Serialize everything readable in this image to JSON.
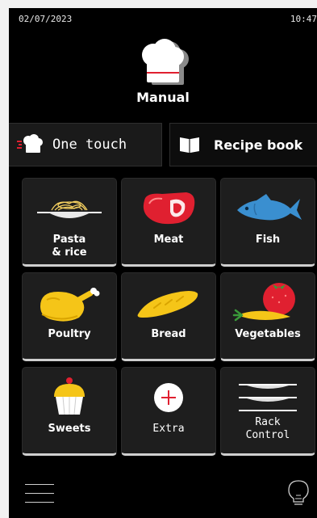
{
  "status": {
    "date": "02/07/2023",
    "time": "10:47"
  },
  "mode": {
    "title": "Manual",
    "icon": "chef-hat-icon"
  },
  "tabs": [
    {
      "label": "One touch",
      "icon": "chef-hat-icon"
    },
    {
      "label": "Recipe book",
      "icon": "open-book-icon"
    }
  ],
  "tiles": [
    {
      "label": "Pasta\n& rice",
      "icon": "pasta-plate-icon"
    },
    {
      "label": "Meat",
      "icon": "steak-icon"
    },
    {
      "label": "Fish",
      "icon": "fish-icon"
    },
    {
      "label": "Poultry",
      "icon": "roast-chicken-icon"
    },
    {
      "label": "Bread",
      "icon": "baguette-icon"
    },
    {
      "label": "Vegetables",
      "icon": "vegetables-icon"
    },
    {
      "label": "Sweets",
      "icon": "cupcake-icon"
    },
    {
      "label": "Extra",
      "icon": "plus-circle-icon"
    },
    {
      "label": "Rack\nControl",
      "icon": "rack-plates-icon"
    }
  ],
  "colors": {
    "background": "#000000",
    "tile": "#1e1e1e",
    "accent": "#e02030",
    "food": "#f5c518"
  }
}
